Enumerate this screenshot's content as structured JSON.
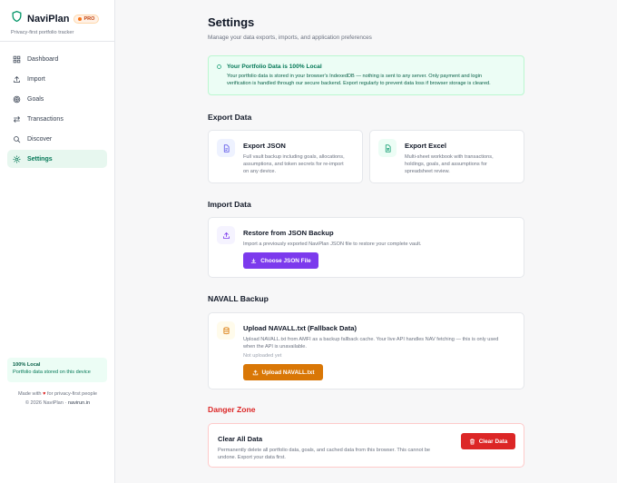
{
  "sidebar": {
    "brand": "NaviPlan",
    "pro_badge": "PRO",
    "tagline": "Privacy-first portfolio tracker",
    "items": [
      {
        "label": "Dashboard",
        "icon": "dashboard-icon"
      },
      {
        "label": "Import",
        "icon": "upload-icon"
      },
      {
        "label": "Goals",
        "icon": "target-icon"
      },
      {
        "label": "Transactions",
        "icon": "swap-icon"
      },
      {
        "label": "Discover",
        "icon": "search-icon"
      },
      {
        "label": "Settings",
        "icon": "gear-icon",
        "active": true
      }
    ],
    "local_title": "100% Local",
    "local_sub": "Portfolio data stored on this device",
    "made_prefix": "Made with",
    "made_suffix": "for privacy-first people",
    "copyright": "© 2026 NaviPlan ·",
    "site": "navirun.in"
  },
  "header": {
    "title": "Settings",
    "subtitle": "Manage your data exports, imports, and application preferences"
  },
  "notice": {
    "title": "Your Portfolio Data is 100% Local",
    "line1": "Your portfolio data is stored in your browser's IndexedDB — nothing is sent to any server. Only payment and login",
    "line2": "verification is handled through our secure backend. Export regularly to prevent data loss if browser storage is cleared."
  },
  "export": {
    "title": "Export Data",
    "json_title": "Export JSON",
    "json_l1": "Full vault backup including goals, allocations,",
    "json_l2": "assumptions, and token secrets for re-import",
    "json_l3": "on any device.",
    "excel_title": "Export Excel",
    "excel_l1": "Multi-sheet workbook with transactions,",
    "excel_l2": "holdings, goals, and assumptions for",
    "excel_l3": "spreadsheet review."
  },
  "import": {
    "title": "Import Data",
    "restore_title": "Restore from JSON Backup",
    "restore_text": "Import a previously exported NaviPlan JSON file to restore your complete vault.",
    "choose_label": "Choose JSON File"
  },
  "navall": {
    "title": "NAVALL Backup",
    "upload_title": "Upload NAVALL.txt (Fallback Data)",
    "l1": "Upload NAVALL.txt from AMFI as a backup fallback cache. Your live API handles NAV fetching — this is only used",
    "l2": "when the API is unavailable.",
    "status": "Not uploaded yet",
    "upload_label": "Upload NAVALL.txt"
  },
  "danger": {
    "title": "Danger Zone",
    "clear_title": "Clear All Data",
    "l1": "Permanently delete all portfolio data, goals, and cached data from this browser. This cannot be",
    "l2": "undone. Export your data first.",
    "clear_label": "Clear Data"
  },
  "colors": {
    "accent_green": "#047857",
    "purple": "#7c3aed",
    "orange": "#d97706",
    "danger": "#dc2626"
  }
}
